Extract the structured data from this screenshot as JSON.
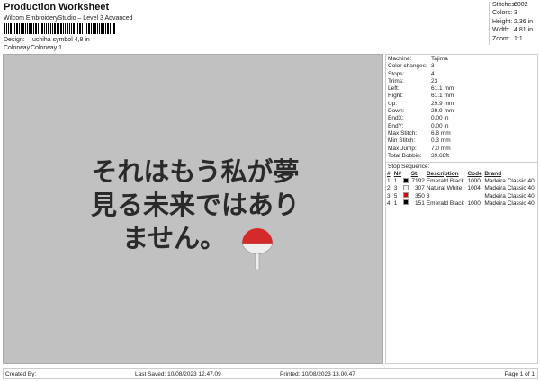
{
  "header": {
    "title": "Production Worksheet",
    "subtitle": "Wilcom EmbroideryStudio – Level 3 Advanced",
    "design_label": "Design:",
    "design_value": "uchiha symbol 4,8 in",
    "colorway_label": "Colorway:",
    "colorway_value": "Colorway 1"
  },
  "stats": [
    {
      "k": "Stitches:",
      "v": "8002"
    },
    {
      "k": "Colors:",
      "v": "3"
    },
    {
      "k": "Height:",
      "v": "2.36 in"
    },
    {
      "k": "Width:",
      "v": "4.81 in"
    },
    {
      "k": "Zoom:",
      "v": "1:1"
    }
  ],
  "design": {
    "lines": [
      "それはもう私が夢",
      "見る未来ではあり",
      "ません。"
    ]
  },
  "machine": [
    {
      "k": "Machine:",
      "v": "Tajima"
    },
    {
      "k": "Color changes:",
      "v": "3"
    },
    {
      "k": "Stops:",
      "v": "4"
    },
    {
      "k": "Trims:",
      "v": "23"
    },
    {
      "k": "Left:",
      "v": "61.1 mm"
    },
    {
      "k": "Right:",
      "v": "61.1 mm"
    },
    {
      "k": "Up:",
      "v": "29.9 mm"
    },
    {
      "k": "Down:",
      "v": "29.9 mm"
    },
    {
      "k": "EndX:",
      "v": "0.00 in"
    },
    {
      "k": "EndY:",
      "v": "0.00 in"
    },
    {
      "k": "Max Stitch:",
      "v": "6.8 mm"
    },
    {
      "k": "Min Stitch:",
      "v": "0.3 mm"
    },
    {
      "k": "Max Jump:",
      "v": "7.0 mm"
    },
    {
      "k": "Total Bobbin:",
      "v": "39.68ft"
    }
  ],
  "stop_sequence": {
    "label": "Stop Sequence:",
    "headers": [
      "#",
      "N#",
      "St.",
      "Description",
      "Code",
      "Brand"
    ],
    "rows": [
      {
        "n": "1.",
        "nn": "1",
        "color": "#000000",
        "st": "7192",
        "desc": "Emerald Black",
        "code": "1000",
        "brand": "Madeira Classic 40"
      },
      {
        "n": "2.",
        "nn": "3",
        "color": "#f2f2f2",
        "st": "307",
        "desc": "Natural White",
        "code": "1004",
        "brand": "Madeira Classic 40"
      },
      {
        "n": "3.",
        "nn": "5",
        "color": "#e00000",
        "st": "350",
        "desc": "3",
        "code": "",
        "brand": "Madeira Classic 40"
      },
      {
        "n": "4.",
        "nn": "1",
        "color": "#000000",
        "st": "151",
        "desc": "Emerald Black",
        "code": "1000",
        "brand": "Madeira Classic 40"
      }
    ]
  },
  "footer": {
    "created": "Created By:",
    "saved": "Last Saved: 10/08/2023 12.47.09",
    "printed": "Printed: 10/08/2023 13.00.47",
    "page": "Page 1 of 1"
  }
}
